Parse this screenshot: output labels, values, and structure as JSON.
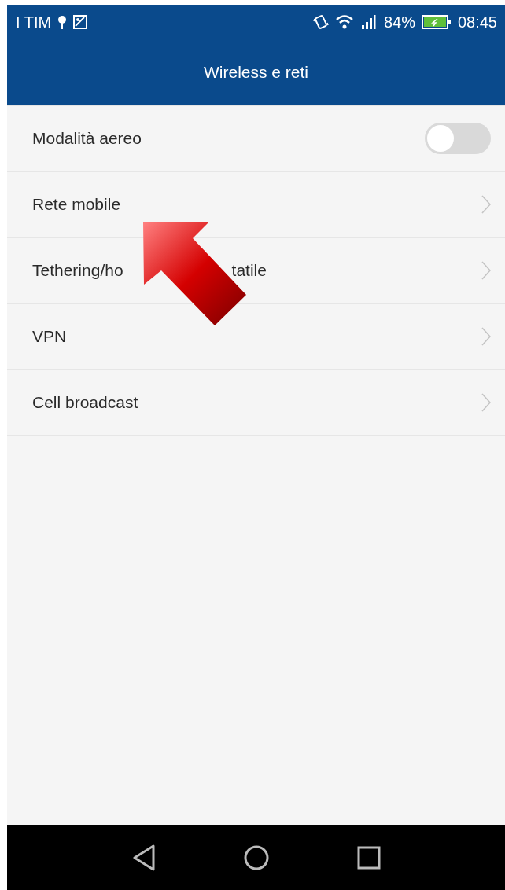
{
  "status_bar": {
    "carrier": "I TIM",
    "battery_percent": "84%",
    "time": "08:45"
  },
  "title": "Wireless e reti",
  "settings": [
    {
      "kind": "toggle",
      "label": "Modalità aereo",
      "on": false
    },
    {
      "kind": "link",
      "label": "Rete mobile"
    },
    {
      "kind": "link",
      "label": "Tethering/ho",
      "label_tail": "tatile"
    },
    {
      "kind": "link",
      "label": "VPN"
    },
    {
      "kind": "link",
      "label": "Cell broadcast"
    }
  ]
}
